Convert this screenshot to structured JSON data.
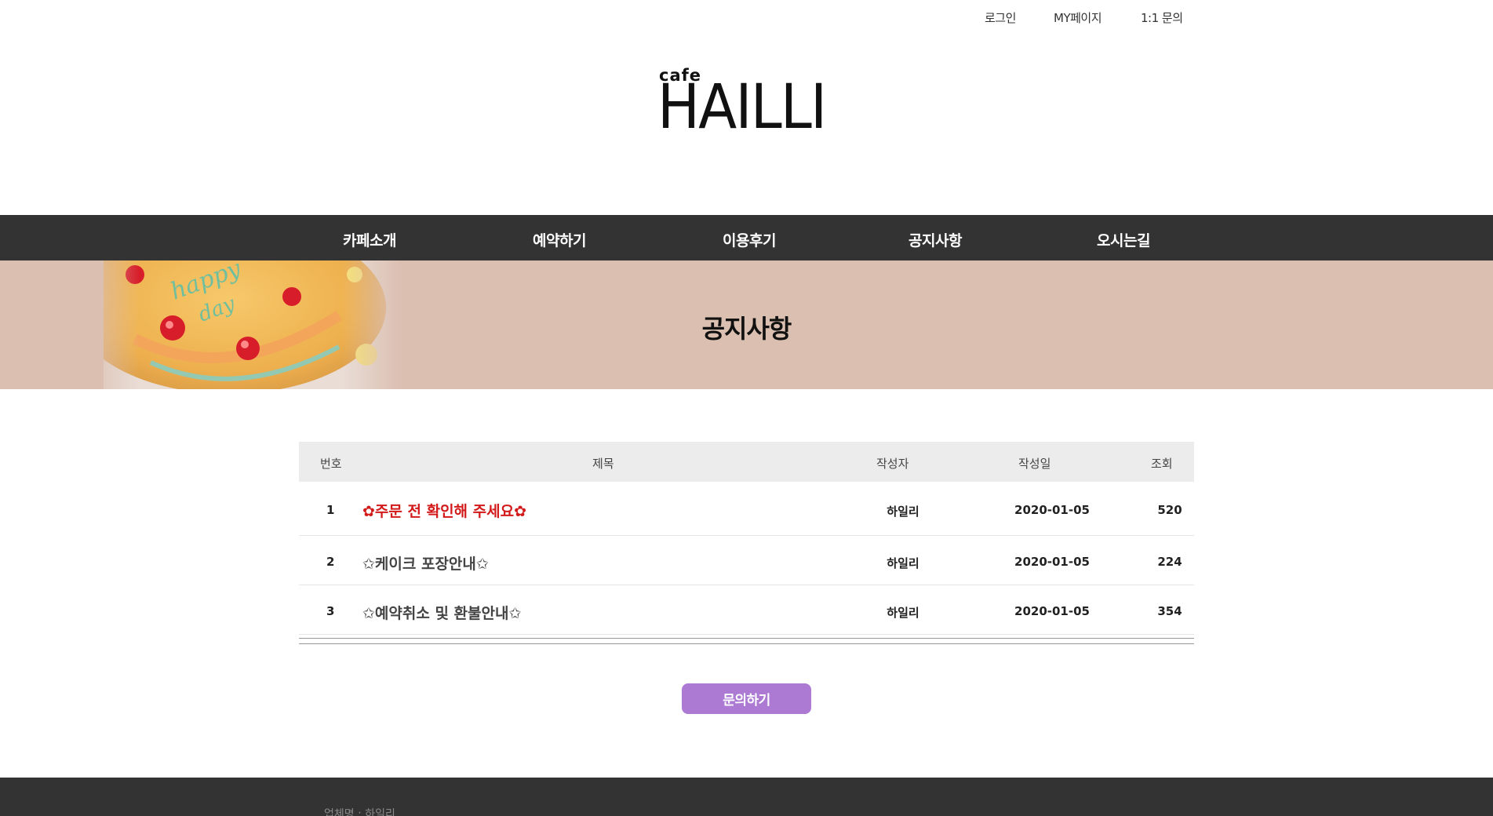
{
  "top_links": {
    "login": "로그인",
    "mypage": "MY페이지",
    "qna": "1:1 문의"
  },
  "logo": {
    "small": "cafe",
    "main": "HAILLI"
  },
  "nav": [
    {
      "label": "카페소개"
    },
    {
      "label": "예약하기"
    },
    {
      "label": "이용후기"
    },
    {
      "label": "공지사항"
    },
    {
      "label": "오시는길"
    }
  ],
  "banner": {
    "title": "공지사항"
  },
  "board": {
    "headers": {
      "no": "번호",
      "title": "제목",
      "author": "작성자",
      "date": "작성일",
      "views": "조회"
    },
    "rows": [
      {
        "no": "1",
        "title": "✿주문 전 확인해 주세요✿",
        "author": "하일리",
        "date": "2020-01-05",
        "views": "520"
      },
      {
        "no": "2",
        "title": "✩케이크 포장안내✩",
        "author": "하일리",
        "date": "2020-01-05",
        "views": "224"
      },
      {
        "no": "3",
        "title": "✩예약취소 및 환불안내✩",
        "author": "하일리",
        "date": "2020-01-05",
        "views": "354"
      }
    ]
  },
  "ask_button": "문의하기",
  "footer": {
    "text": "업체명 : 하일리"
  },
  "colors": {
    "nav_bg": "#333333",
    "banner_bg": "#dbbfb1",
    "important_title": "#d21a1a",
    "button_bg": "#ac79d3"
  }
}
